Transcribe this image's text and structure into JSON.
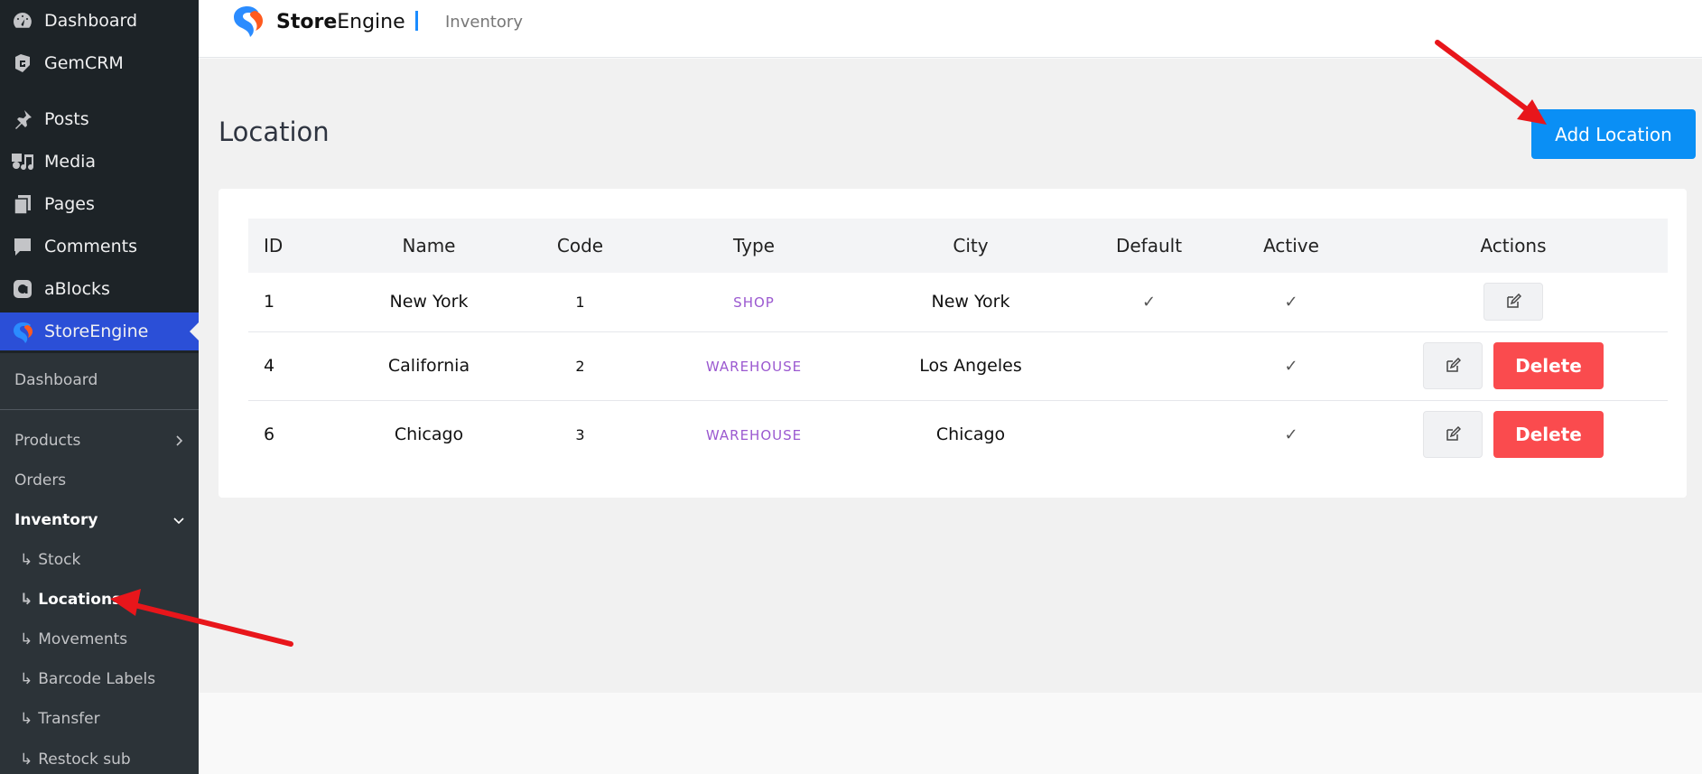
{
  "sidebar": {
    "top_items": [
      {
        "label": "Dashboard",
        "icon": "dashboard-icon"
      },
      {
        "label": "GemCRM",
        "icon": "gemcrm-icon"
      },
      {
        "label": "Posts",
        "icon": "pin-icon"
      },
      {
        "label": "Media",
        "icon": "media-icon"
      },
      {
        "label": "Pages",
        "icon": "pages-icon"
      },
      {
        "label": "Comments",
        "icon": "comment-icon"
      },
      {
        "label": "aBlocks",
        "icon": "ablocks-icon"
      },
      {
        "label": "StoreEngine",
        "icon": "storeengine-icon"
      }
    ],
    "sub_items": {
      "dashboard": "Dashboard",
      "products": "Products",
      "orders": "Orders",
      "inventory": "Inventory",
      "stock": "Stock",
      "locations": "Locations",
      "movements": "Movements",
      "barcode": "Barcode Labels",
      "transfer": "Transfer",
      "restock": "Restock sub"
    },
    "child_prefix": "↳"
  },
  "header": {
    "brand_bold": "Store",
    "brand_rest": "Engine",
    "breadcrumb": "Inventory"
  },
  "main": {
    "title": "Location",
    "add_button": "Add Location"
  },
  "table": {
    "columns": [
      "ID",
      "Name",
      "Code",
      "Type",
      "City",
      "Default",
      "Active",
      "Actions"
    ],
    "rows": [
      {
        "id": "1",
        "name": "New York",
        "code": "1",
        "type": "SHOP",
        "city": "New York",
        "default": "✓",
        "active": "✓",
        "delete": ""
      },
      {
        "id": "4",
        "name": "California",
        "code": "2",
        "type": "WAREHOUSE",
        "city": "Los Angeles",
        "default": "",
        "active": "✓",
        "delete": "Delete"
      },
      {
        "id": "6",
        "name": "Chicago",
        "code": "3",
        "type": "WAREHOUSE",
        "city": "Chicago",
        "default": "",
        "active": "✓",
        "delete": "Delete"
      }
    ]
  },
  "colors": {
    "sidebar_bg": "#1d2327",
    "active_menu": "#2b4fd7",
    "primary_button": "#0a8ff5",
    "delete_button": "#fa4b4e",
    "type_badge": "#9b59d0",
    "annotation_arrow": "#e8161b"
  }
}
